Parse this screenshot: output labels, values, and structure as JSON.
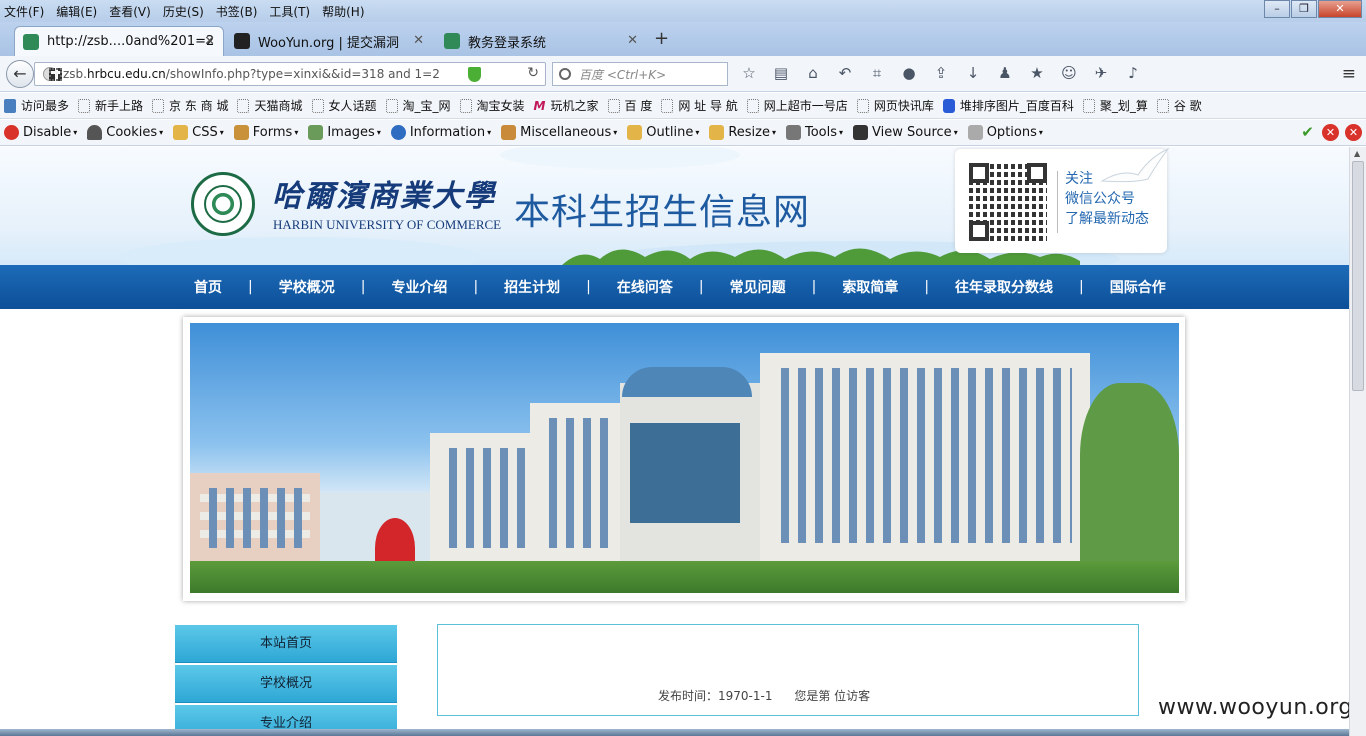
{
  "menubar": {
    "items": [
      "文件(F)",
      "编辑(E)",
      "查看(V)",
      "历史(S)",
      "书签(B)",
      "工具(T)",
      "帮助(H)"
    ]
  },
  "tabs": [
    {
      "title": "http://zsb....0and%201=2",
      "active": true
    },
    {
      "title": "WooYun.org | 提交漏洞",
      "active": false
    },
    {
      "title": "教务登录系统",
      "active": false
    }
  ],
  "url": {
    "prefix": "zsb.",
    "domain": "hrbcu.edu.cn",
    "path": "/showInfo.php?type=xinxi&&id=318 and 1=2"
  },
  "search": {
    "placeholder": "百度 <Ctrl+K>"
  },
  "bookmarks": [
    "访问最多",
    "新手上路",
    "京 东 商 城",
    "天猫商城",
    "女人话题",
    "淘_宝_网",
    "淘宝女装",
    "玩机之家",
    "百 度",
    "网 址 导 航",
    "网上超市一号店",
    "网页快讯库",
    "堆排序图片_百度百科",
    "聚_划_算",
    "谷 歌"
  ],
  "webdev": [
    "Disable",
    "Cookies",
    "CSS",
    "Forms",
    "Images",
    "Information",
    "Miscellaneous",
    "Outline",
    "Resize",
    "Tools",
    "View Source",
    "Options"
  ],
  "header": {
    "university_cn": "哈爾濱商業大學",
    "university_en": "HARBIN UNIVERSITY OF COMMERCE",
    "site_title": "本科生招生信息网",
    "qr_lines": [
      "关注",
      "微信公众号",
      "了解最新动态"
    ]
  },
  "nav": [
    "首页",
    "学校概况",
    "专业介绍",
    "招生计划",
    "在线问答",
    "常见问题",
    "索取简章",
    "往年录取分数线",
    "国际合作"
  ],
  "nav_separator": "|",
  "sidebar": [
    "本站首页",
    "学校概况",
    "专业介绍"
  ],
  "content": {
    "publish_label": "发布时间：1970-1-1",
    "visitor_label": "您是第 位访客"
  },
  "watermark": "www.wooyun.org",
  "colors": {
    "nav_blue": "#0d4f98",
    "sidebar_cyan": "#2ea7d6",
    "title_blue": "#1e5aa0"
  }
}
